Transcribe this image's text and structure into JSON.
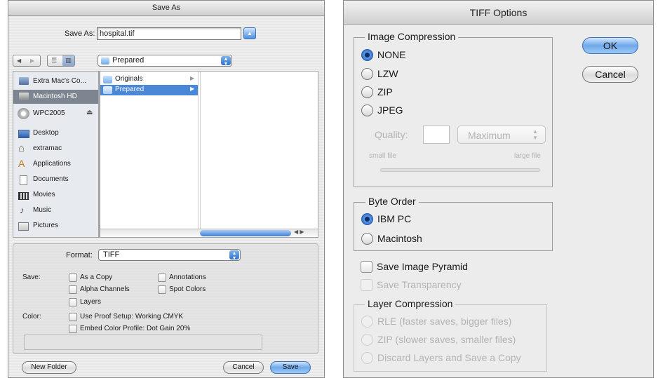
{
  "save_dialog": {
    "title": "Save As",
    "save_as_label": "Save As:",
    "filename": "hospital.tif",
    "location": "Prepared",
    "sidebar": {
      "devices": [
        "Extra Mac's Co...",
        "Macintosh HD",
        "WPC2005"
      ],
      "places": [
        "Desktop",
        "extramac",
        "Applications",
        "Documents",
        "Movies",
        "Music",
        "Pictures"
      ]
    },
    "column_items": [
      "Originals",
      "Prepared"
    ],
    "format_label": "Format:",
    "format_value": "TIFF",
    "save_label": "Save:",
    "options": {
      "as_a_copy": "As a Copy",
      "annotations": "Annotations",
      "alpha_channels": "Alpha Channels",
      "spot_colors": "Spot Colors",
      "layers": "Layers"
    },
    "color_label": "Color:",
    "use_proof_setup": "Use Proof Setup:  Working CMYK",
    "embed_color_profile": "Embed Color Profile:  Dot Gain 20%",
    "new_folder": "New Folder",
    "cancel": "Cancel",
    "save": "Save"
  },
  "tiff_dialog": {
    "title": "TIFF Options",
    "image_compression": {
      "legend": "Image Compression",
      "options": [
        "NONE",
        "LZW",
        "ZIP",
        "JPEG"
      ],
      "selected": "NONE",
      "quality_label": "Quality:",
      "quality_value": "",
      "quality_preset": "Maximum",
      "small_file": "small file",
      "large_file": "large file"
    },
    "byte_order": {
      "legend": "Byte Order",
      "options": [
        "IBM PC",
        "Macintosh"
      ],
      "selected": "IBM PC"
    },
    "save_image_pyramid": "Save Image Pyramid",
    "save_transparency": "Save Transparency",
    "layer_compression": {
      "legend": "Layer Compression",
      "options": [
        "RLE (faster saves, bigger files)",
        "ZIP (slower saves, smaller files)",
        "Discard Layers and Save a Copy"
      ]
    },
    "ok": "OK",
    "cancel": "Cancel"
  },
  "colors": {
    "selection_blue": "#4a87d6",
    "aqua_blue": "#6fa8ea"
  },
  "icons": [
    "harddisk-icon",
    "network-disk-icon",
    "eject-icon",
    "desktop-icon",
    "home-icon",
    "applications-icon",
    "documents-icon",
    "movies-icon",
    "music-icon",
    "pictures-icon",
    "folder-icon"
  ]
}
